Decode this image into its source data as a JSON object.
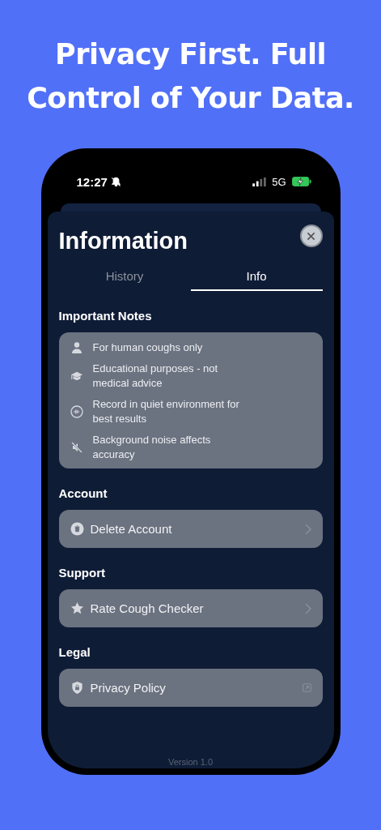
{
  "headline": "Privacy First. Full Control of Your Data.",
  "status_bar": {
    "time": "12:27",
    "network": "5G"
  },
  "sheet": {
    "title": "Information",
    "tabs": [
      {
        "label": "History",
        "selected": false
      },
      {
        "label": "Info",
        "selected": true
      }
    ],
    "notes": {
      "heading": "Important Notes",
      "items": [
        "For human coughs only",
        "Educational purposes - not medical advice",
        "Record in quiet environment for best results",
        "Background noise affects accuracy"
      ]
    },
    "sections": [
      {
        "heading": "Account",
        "row": {
          "label": "Delete Account",
          "kind": "chevron"
        }
      },
      {
        "heading": "Support",
        "row": {
          "label": "Rate Cough Checker",
          "kind": "chevron"
        }
      },
      {
        "heading": "Legal",
        "row": {
          "label": "Privacy Policy",
          "kind": "external"
        }
      }
    ],
    "version": "Version 1.0"
  }
}
